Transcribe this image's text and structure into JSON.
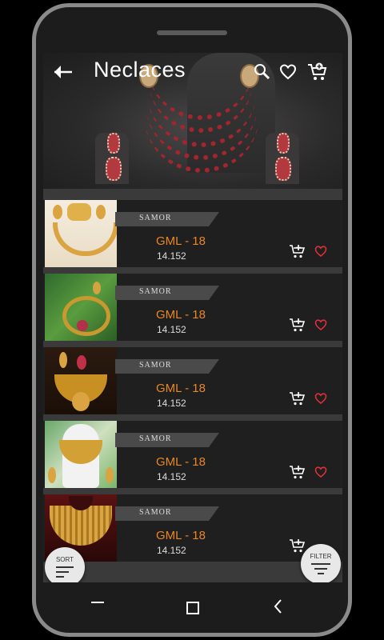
{
  "header": {
    "title": "Neclaces"
  },
  "icons": {
    "back": "back-arrow-icon",
    "search": "search-icon",
    "wishlist": "heart-outline-icon",
    "cart": "cart-icon"
  },
  "products": [
    {
      "brand": "SAMOR",
      "name": "GML - 18",
      "price": "14.152",
      "has_heart": true
    },
    {
      "brand": "SAMOR",
      "name": "GML - 18",
      "price": "14.152",
      "has_heart": true
    },
    {
      "brand": "SAMOR",
      "name": "GML - 18",
      "price": "14.152",
      "has_heart": true
    },
    {
      "brand": "SAMOR",
      "name": "GML - 18",
      "price": "14.152",
      "has_heart": true
    },
    {
      "brand": "SAMOR",
      "name": "GML - 18",
      "price": "14.152",
      "has_heart": false
    }
  ],
  "fab": {
    "sort_label": "SORT",
    "filter_label": "FILTER"
  },
  "colors": {
    "accent": "#e8862a",
    "heart": "#e0303a",
    "background": "#2a2a2a"
  }
}
